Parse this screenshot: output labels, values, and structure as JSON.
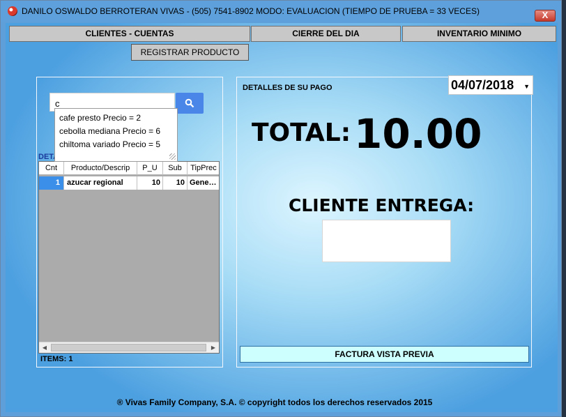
{
  "window": {
    "title": "DANILO OSWALDO BERROTERAN VIVAS - (505) 7541-8902 MODO:  EVALUACION  (TIEMPO DE PRUEBA = 33 VECES)",
    "close_label": "X"
  },
  "nav": {
    "clientes": "CLIENTES - CUENTAS",
    "cierre": "CIERRE DEL DIA",
    "inventario": "INVENTARIO MINIMO",
    "registrar": "REGISTRAR PRODUCTO"
  },
  "search": {
    "value": "c",
    "suggestions": [
      "cafe presto Precio = 2",
      "cebolla mediana Precio = 6",
      "chiltoma variado Precio = 5"
    ]
  },
  "grid": {
    "section_label": "DETA",
    "columns": [
      "Cnt",
      "Producto/Descrip",
      "P_U",
      "Sub",
      "TipPrec"
    ],
    "rows": [
      [
        "1",
        "azucar regional",
        "10",
        "10",
        "Gene…"
      ]
    ],
    "items_label": "ITEMS: 1"
  },
  "payment": {
    "section_label": "DETALLES DE SU PAGO",
    "date": "04/07/2018",
    "total_label": "TOTAL:",
    "total_value": "10.00",
    "cliente_label": "CLIENTE  ENTREGA:",
    "cliente_value": "",
    "factura_button": "FACTURA VISTA PREVIA"
  },
  "footer": "® Vivas Family Company, S.A. © copyright todos los derechos reservados 2015",
  "icons": {
    "app": "app-logo-icon",
    "search": "search-icon",
    "close": "close-icon",
    "dropdown": "chevron-down-icon"
  },
  "colors": {
    "accent_blue": "#4a86e8",
    "selected_cell": "#3b8fe8",
    "factura_bg": "#ccfffe",
    "close_red": "#c53a2c"
  }
}
